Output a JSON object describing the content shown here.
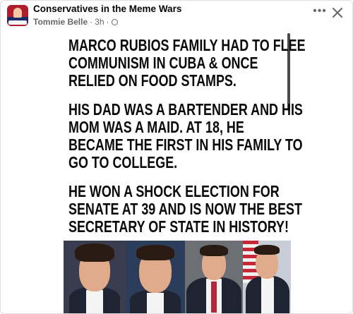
{
  "post": {
    "group_name": "Conservatives in the Meme Wars",
    "author": "Tommie Belle",
    "time": "3h",
    "separator": "·",
    "privacy_icon": "globe-icon",
    "more_icon": "more-horizontal-icon",
    "close_icon": "close-icon"
  },
  "meme": {
    "paragraphs": [
      [
        "MARCO RUBIOS FAMILY HAD TO FLEE",
        "COMMUNISM IN CUBA & ONCE",
        "RELIED ON FOOD STAMPS."
      ],
      [
        "HIS DAD WAS A BARTENDER AND HIS",
        "MOM WAS A MAID. AT 18, HE",
        "BECAME THE FIRST IN HIS FAMILY TO",
        "GO TO COLLEGE."
      ],
      [
        "HE WON A SHOCK ELECTION FOR",
        "SENATE AT 39 AND IS NOW THE BEST",
        "SECRETARY OF STATE IN HISTORY!"
      ]
    ],
    "volume_icon": "volume-icon"
  },
  "colors": {
    "text_primary": "#050505",
    "text_secondary": "#65676b",
    "meme_text": "#0a0a0a"
  }
}
